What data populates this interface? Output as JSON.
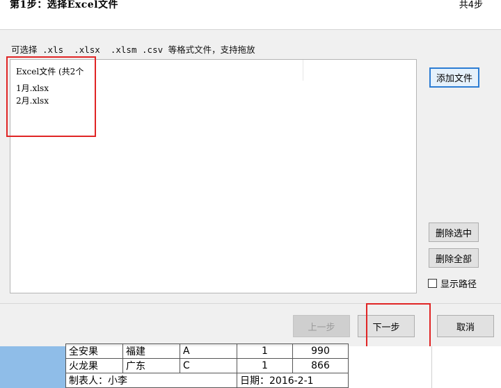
{
  "header": {
    "title": "第1步：选择Excel文件",
    "step_count": "共4步"
  },
  "main": {
    "hint": "可选择 .xls  .xlsx  .xlsm .csv 等格式文件，支持拖放",
    "list_header": "Excel文件 (共2个",
    "files": [
      "1月.xlsx",
      "2月.xlsx"
    ],
    "add_button": "添加文件",
    "delete_selected_button": "删除选中",
    "delete_all_button": "删除全部",
    "show_path_label": "显示路径",
    "show_path_checked": false
  },
  "footer": {
    "prev_button": "上一步",
    "next_button": "下一步",
    "cancel_button": "取消"
  },
  "sheet": {
    "rows": [
      [
        "全安果",
        "福建",
        "A",
        "1",
        "990"
      ],
      [
        "火龙果",
        "广东",
        "C",
        "1",
        "866"
      ]
    ],
    "maker": "制表人：小李",
    "date": "日期：2016-2-1"
  },
  "colors": {
    "highlight_box": "#e02424",
    "focus_border": "#2b7cd3",
    "sheet_selection": "#8fbde8"
  }
}
